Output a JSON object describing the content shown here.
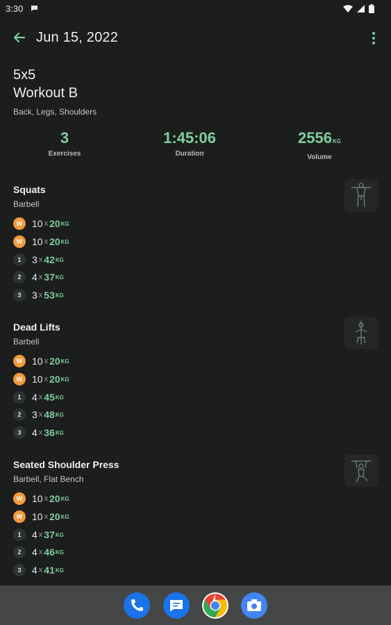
{
  "status": {
    "time": "3:30"
  },
  "header": {
    "date": "Jun 15, 2022"
  },
  "workout": {
    "program": "5x5",
    "name": "Workout B",
    "muscles": "Back, Legs, Shoulders"
  },
  "stats": {
    "exercises": {
      "value": "3",
      "label": "Exercises"
    },
    "duration": {
      "value": "1:45:06",
      "label": "Duration"
    },
    "volume": {
      "value": "2556",
      "unit": "KG",
      "label": "Volume"
    }
  },
  "set_symbols": {
    "times": "x",
    "unit": "KG"
  },
  "exercises": [
    {
      "name": "Squats",
      "equipment": "Barbell",
      "sets": [
        {
          "badge": "W",
          "reps": "10",
          "weight": "20"
        },
        {
          "badge": "W",
          "reps": "10",
          "weight": "20"
        },
        {
          "badge": "1",
          "reps": "3",
          "weight": "42"
        },
        {
          "badge": "2",
          "reps": "4",
          "weight": "37"
        },
        {
          "badge": "3",
          "reps": "3",
          "weight": "53"
        }
      ]
    },
    {
      "name": "Dead Lifts",
      "equipment": "Barbell",
      "sets": [
        {
          "badge": "W",
          "reps": "10",
          "weight": "20"
        },
        {
          "badge": "W",
          "reps": "10",
          "weight": "20"
        },
        {
          "badge": "1",
          "reps": "4",
          "weight": "45"
        },
        {
          "badge": "2",
          "reps": "3",
          "weight": "48"
        },
        {
          "badge": "3",
          "reps": "4",
          "weight": "36"
        }
      ]
    },
    {
      "name": "Seated Shoulder Press",
      "equipment": "Barbell, Flat Bench",
      "sets": [
        {
          "badge": "W",
          "reps": "10",
          "weight": "20"
        },
        {
          "badge": "W",
          "reps": "10",
          "weight": "20"
        },
        {
          "badge": "1",
          "reps": "4",
          "weight": "37"
        },
        {
          "badge": "2",
          "reps": "4",
          "weight": "46"
        },
        {
          "badge": "3",
          "reps": "4",
          "weight": "41"
        }
      ]
    }
  ],
  "dock": [
    {
      "icon": "phone-icon",
      "color": "#1a73e8"
    },
    {
      "icon": "messages-icon",
      "color": "#1a73e8"
    },
    {
      "icon": "chrome-icon",
      "color": "#ffffff"
    },
    {
      "icon": "camera-icon",
      "color": "#4285f4"
    }
  ],
  "colors": {
    "accent": "#7fcf9b",
    "warmup": "#f29a3c",
    "background": "#1c1d1d"
  }
}
